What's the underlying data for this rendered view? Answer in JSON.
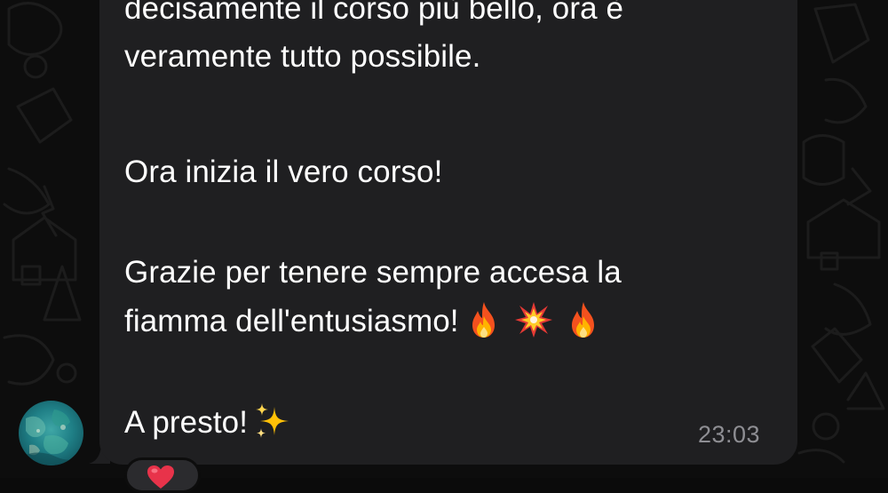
{
  "message": {
    "lines": [
      "decisamente il corso più bello, ora è",
      "veramente tutto possibile.",
      "Ora inizia il vero corso!",
      "Grazie per tenere sempre accesa la",
      "fiamma dell'entusiasmo!",
      "A presto!"
    ],
    "emojis_line5": [
      "fire-emoji",
      "collision-emoji",
      "fire-emoji"
    ],
    "emoji_line6": "sparkles-emoji",
    "timestamp": "23:03"
  },
  "reaction": {
    "icon": "red-heart-emoji"
  },
  "colors": {
    "background": "#0d0d0d",
    "bubble": "#1f1f21",
    "text": "#ffffff",
    "timestamp": "#8e8e93",
    "reaction_bg": "#2b2b2e",
    "heart": "#e8334a"
  }
}
